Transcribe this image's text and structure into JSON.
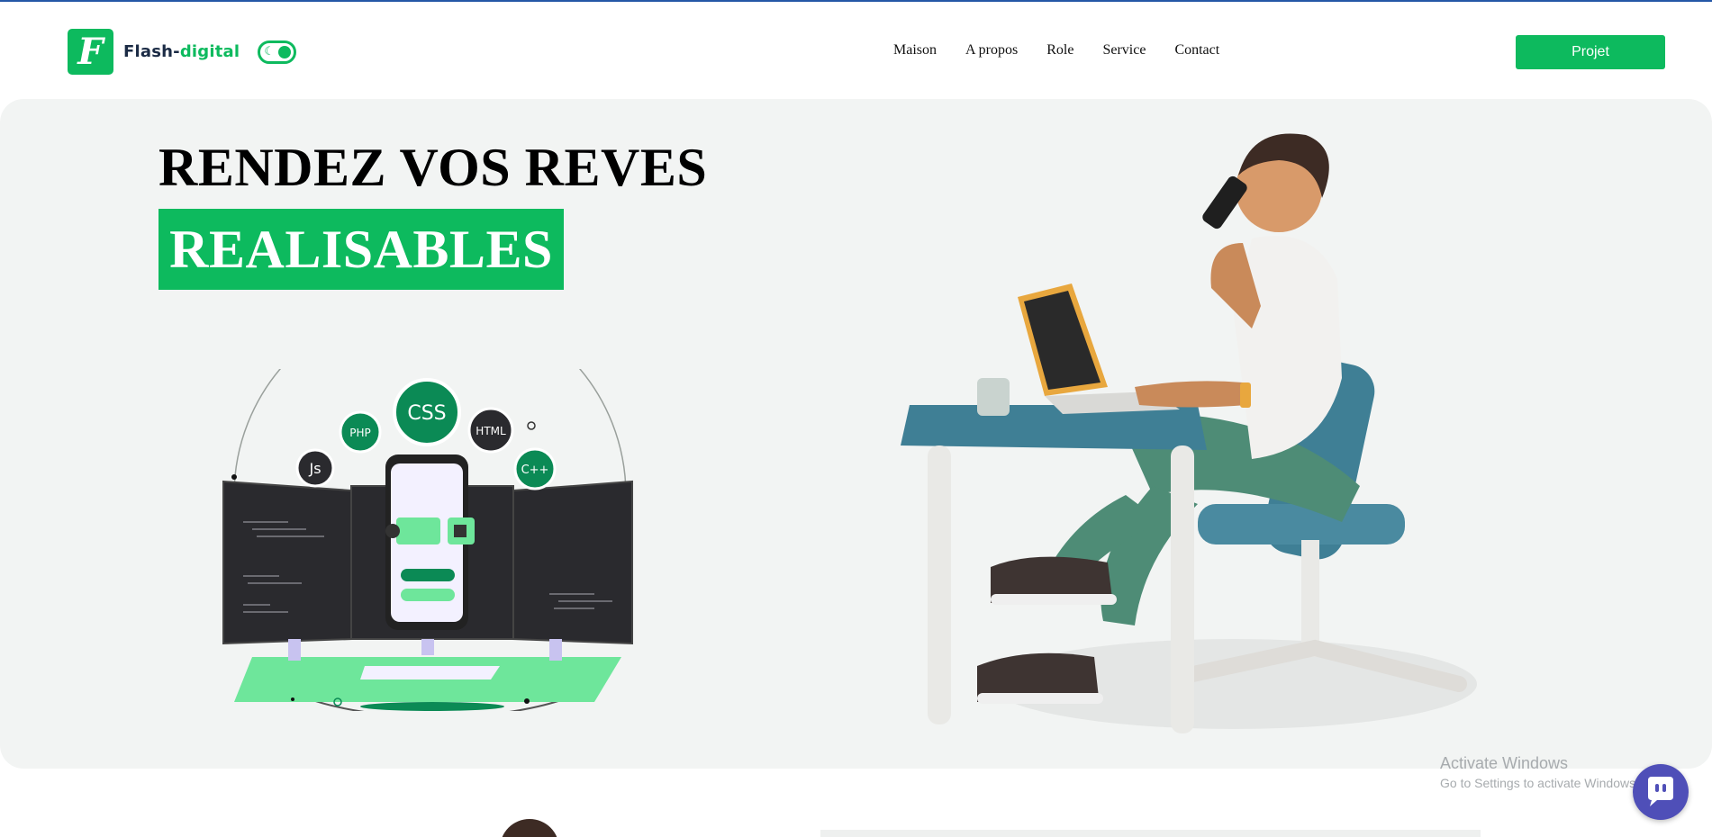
{
  "header": {
    "logo_letter": "F",
    "brand_prefix": "Flash-",
    "brand_suffix": "digital",
    "theme_toggle_icon": "moon-icon",
    "nav": [
      "Maison",
      "A propos",
      "Role",
      "Service",
      "Contact"
    ],
    "cta_label": "Projet"
  },
  "hero": {
    "title_line1": "RENDEZ VOS REVES",
    "title_line2": "REALISABLES",
    "tech_badges": [
      "Js",
      "PHP",
      "CSS",
      "HTML",
      "C++"
    ]
  },
  "os_overlay": {
    "activate_title": "Activate Windows",
    "activate_sub": "Go to Settings to activate Windows."
  },
  "colors": {
    "accent": "#0dba5e",
    "hero_bg": "#f2f4f3",
    "chat": "#4f4fb8"
  }
}
